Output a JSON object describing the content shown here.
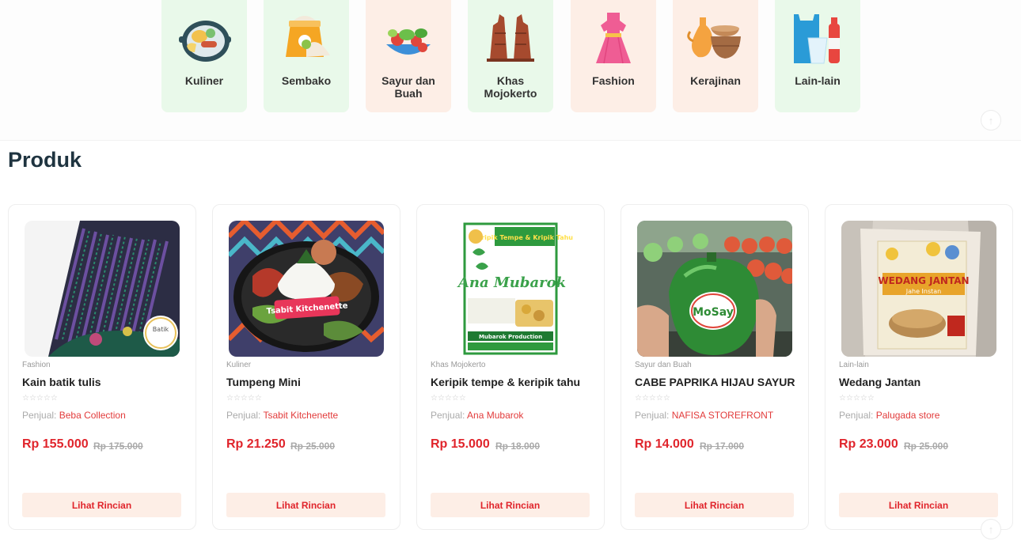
{
  "categories": [
    {
      "label": "Kuliner",
      "icon": "food-plate-icon",
      "theme": "green"
    },
    {
      "label": "Sembako",
      "icon": "rice-sack-icon",
      "theme": "green"
    },
    {
      "label": "Sayur dan Buah",
      "icon": "vegetable-bowl-icon",
      "theme": "peach"
    },
    {
      "label": "Khas Mojokerto",
      "icon": "temple-gate-icon",
      "theme": "green"
    },
    {
      "label": "Fashion",
      "icon": "dress-icon",
      "theme": "peach"
    },
    {
      "label": "Kerajinan",
      "icon": "pottery-icon",
      "theme": "peach"
    },
    {
      "label": "Lain-lain",
      "icon": "bottles-icon",
      "theme": "green"
    }
  ],
  "section_title": "Produk",
  "seller_prefix": "Penjual:",
  "button_label": "Lihat Rincian",
  "colors": {
    "accent": "#e0242b",
    "green_bg": "#e9f9ea",
    "peach_bg": "#fdeee6"
  },
  "products": [
    {
      "category": "Fashion",
      "name": "Kain batik tulis",
      "rating": "☆☆☆☆☆",
      "seller": "Beba Collection",
      "price": "Rp 155.000",
      "old_price": "Rp 175.000"
    },
    {
      "category": "Kuliner",
      "name": "Tumpeng Mini",
      "rating": "☆☆☆☆☆",
      "seller": "Tsabit Kitchenette",
      "price": "Rp 21.250",
      "old_price": "Rp 25.000"
    },
    {
      "category": "Khas Mojokerto",
      "name": "Keripik tempe & keripik tahu",
      "rating": "☆☆☆☆☆",
      "seller": "Ana Mubarok",
      "price": "Rp 15.000",
      "old_price": "Rp 18.000"
    },
    {
      "category": "Sayur dan Buah",
      "name": "CABE PAPRIKA HIJAU SAYUR",
      "rating": "☆☆☆☆☆",
      "seller": "NAFISA STOREFRONT",
      "price": "Rp 14.000",
      "old_price": "Rp 17.000"
    },
    {
      "category": "Lain-lain",
      "name": "Wedang Jantan",
      "rating": "☆☆☆☆☆",
      "seller": "Palugada store",
      "price": "Rp 23.000",
      "old_price": "Rp 25.000"
    }
  ],
  "image_text": {
    "batik_badge": "Batik",
    "tumpeng_sign": "Tsabit Kitchenette",
    "keripik_header": "Kripik Tempe & Kripik Tahu",
    "keripik_brand": "Ana Mubarok",
    "keripik_footer": "Mubarok Production",
    "paprika_label": "MoSay",
    "wedang_title": "WEDANG JANTAN",
    "wedang_sub": "Jahe Instan"
  },
  "scroll_top_icon": "arrow-up-icon"
}
